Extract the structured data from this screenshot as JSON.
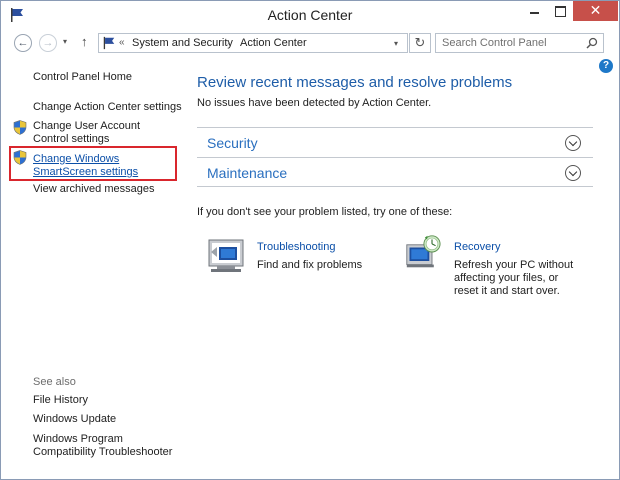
{
  "window": {
    "title": "Action Center",
    "close_glyph": "✕",
    "buttons": [
      "minimize",
      "maximize",
      "close"
    ]
  },
  "nav": {
    "back_glyph": "←",
    "forward_glyph": "→",
    "up_glyph": "↑",
    "dropdown_glyph": "▾",
    "breadcrumb_overflow": "«",
    "breadcrumb_sep": "›",
    "breadcrumbs": [
      "System and Security",
      "Action Center"
    ],
    "refresh_glyph": "↻",
    "search_placeholder": "Search Control Panel",
    "help_glyph": "?"
  },
  "sidebar": {
    "items": [
      {
        "label": "Control Panel Home"
      },
      {
        "label": "Change Action Center settings"
      },
      {
        "label": "Change User Account Control settings",
        "icon": "shield-icon"
      },
      {
        "label": "Change Windows SmartScreen settings",
        "icon": "shield-icon",
        "highlighted": true
      },
      {
        "label": "View archived messages"
      }
    ],
    "see_also_heading": "See also",
    "see_also": [
      {
        "label": "File History"
      },
      {
        "label": "Windows Update"
      },
      {
        "label": "Windows Program Compatibility Troubleshooter"
      }
    ]
  },
  "main": {
    "heading": "Review recent messages and resolve problems",
    "status": "No issues have been detected by Action Center.",
    "sections": [
      {
        "label": "Security"
      },
      {
        "label": "Maintenance"
      }
    ],
    "try_text": "If you don't see your problem listed, try one of these:",
    "tools": [
      {
        "title": "Troubleshooting",
        "description": "Find and fix problems",
        "icon": "troubleshooting-icon"
      },
      {
        "title": "Recovery",
        "description": "Refresh your PC without affecting your files, or reset it and start over.",
        "icon": "recovery-icon"
      }
    ]
  },
  "colors": {
    "heading_blue": "#1e5da8",
    "link_blue": "#0b4fa8",
    "highlight_red": "#d9262d",
    "close_button": "#c7504a"
  }
}
